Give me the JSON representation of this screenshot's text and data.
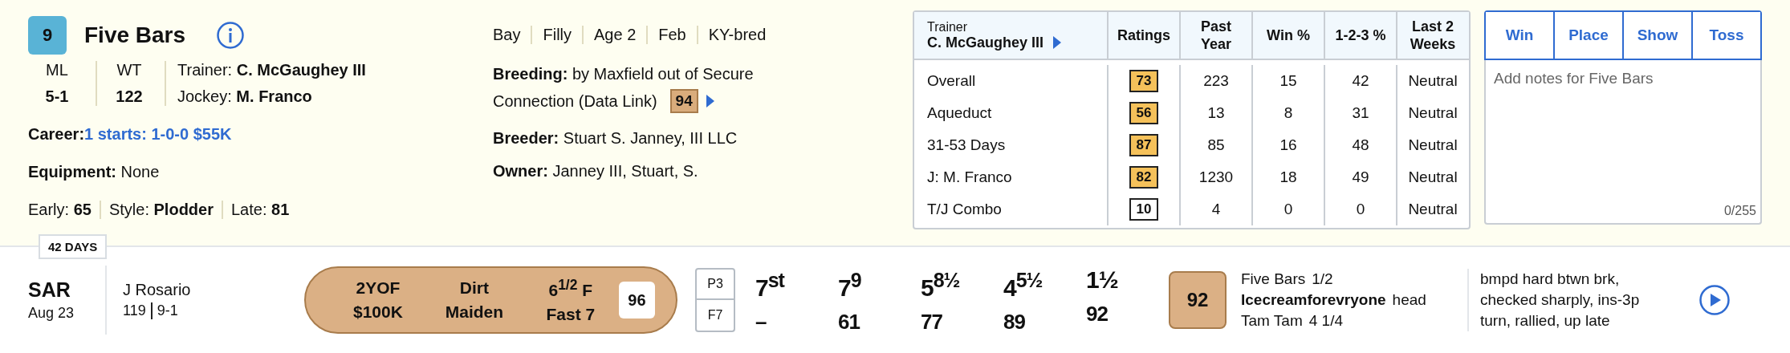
{
  "horse": {
    "number": "9",
    "name": "Five Bars",
    "ml_label": "ML",
    "ml": "5-1",
    "wt_label": "WT",
    "wt": "122",
    "trainer": "Trainer: **C. McGaughey III**",
    "jockey": "Jockey: **M. Franco**",
    "career_label": "Career:",
    "career": "1 starts: 1-0-0 $55K",
    "equipment": "**Equipment:** None",
    "stats": [
      {
        "text": "Early: **65**"
      },
      {
        "text": "Style: **Plodder**"
      },
      {
        "text": "Late: **81**"
      }
    ]
  },
  "attributes": [
    "Bay",
    "Filly",
    "Age 2",
    "Feb",
    "KY-bred"
  ],
  "breeding": {
    "lines": [
      "**Breeding:** by Maxfield out of Secure",
      "Connection (Data Link)"
    ],
    "rating": "94"
  },
  "breeder": "**Breeder:** Stuart S. Janney, III LLC",
  "owner": "**Owner:** Janney III, Stuart, S.",
  "trainer_table": {
    "header_label": "Trainer",
    "header_name": "C. McGaughey III",
    "columns": [
      "Ratings",
      "Past Year",
      "Win %",
      "1-2-3 %",
      "Last 2 Weeks"
    ],
    "rows": [
      {
        "label": "Overall",
        "rating": "73",
        "color": "#f5c15a",
        "past_year": "223",
        "win": "15",
        "top3": "42",
        "last2": "Neutral"
      },
      {
        "label": "Aqueduct",
        "rating": "56",
        "color": "#f5c15a",
        "past_year": "13",
        "win": "8",
        "top3": "31",
        "last2": "Neutral"
      },
      {
        "label": "31-53 Days",
        "rating": "87",
        "color": "#f5c15a",
        "past_year": "85",
        "win": "16",
        "top3": "48",
        "last2": "Neutral"
      },
      {
        "label": "J: M. Franco",
        "rating": "82",
        "color": "#f5c15a",
        "past_year": "1230",
        "win": "18",
        "top3": "49",
        "last2": "Neutral"
      },
      {
        "label": "T/J Combo",
        "rating": "10",
        "color": "#ffffff",
        "past_year": "4",
        "win": "0",
        "top3": "0",
        "last2": "Neutral"
      }
    ]
  },
  "notes": {
    "buttons": [
      {
        "label": "Win",
        "selected": false
      },
      {
        "label": "Place",
        "selected": false
      },
      {
        "label": "Show",
        "selected": false
      },
      {
        "label": "Toss",
        "selected": false
      }
    ],
    "placeholder": "Add notes for Five Bars",
    "counter": "0/255"
  },
  "past_performance": {
    "days_badge": "42 DAYS",
    "track": "SAR",
    "date": "Aug 23",
    "jockey": "J Rosario",
    "weight": "119",
    "odds": "9-1",
    "race": [
      {
        "top": "2YOF",
        "bottom": "$100K"
      },
      {
        "top": "Dirt",
        "bottom": "Maiden"
      },
      {
        "top": "6$^{1/2}$ F",
        "bottom": "Fast 7"
      }
    ],
    "speed": "96",
    "post": "P3",
    "field": "F7",
    "calls": [
      {
        "position": "7$^{st}$",
        "figure": "–"
      },
      {
        "position": "7$^{9}$",
        "figure": "61"
      },
      {
        "position": "5$^{8½}$",
        "figure": "77"
      },
      {
        "position": "4$^{5½}$",
        "figure": "89"
      },
      {
        "position": "1½",
        "figure": "92"
      }
    ],
    "figure": "92",
    "finishers": [
      {
        "name": "Five Bars",
        "margin": "1/2",
        "bold": false
      },
      {
        "name": "Icecreamforevryone",
        "margin": "head",
        "bold": true
      },
      {
        "name": "Tam Tam",
        "margin": "4 1/4",
        "bold": false
      }
    ],
    "comment": "bmpd hard btwn brk, checked sharply, ins-3p turn, rallied, up late"
  }
}
